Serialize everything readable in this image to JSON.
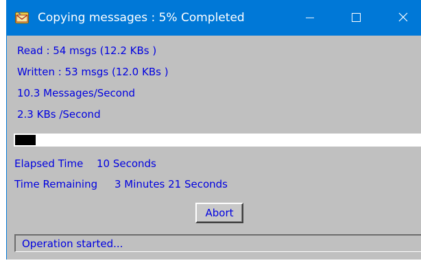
{
  "window": {
    "title": "Copying messages : 5% Completed",
    "controls": {
      "minimize_icon": "minimize-icon",
      "maximize_icon": "maximize-icon",
      "close_icon": "close-icon"
    },
    "app_icon": "mail-envelope-icon"
  },
  "stats": {
    "read": "Read : 54 msgs (12.2 KBs )",
    "written": "Written : 53 msgs (12.0 KBs )",
    "messages_rate": "10.3 Messages/Second",
    "kb_rate": "2.3 KBs /Second"
  },
  "progress": {
    "percent": 5
  },
  "timing": {
    "elapsed_label": "Elapsed Time",
    "elapsed_value": "10 Seconds",
    "remaining_label": "Time Remaining",
    "remaining_value": "3 Minutes 21 Seconds"
  },
  "actions": {
    "abort_label": "Abort"
  },
  "status": {
    "text": "Operation started..."
  },
  "colors": {
    "titlebar": "#0078d7",
    "dialog_bg": "#c0c0c0",
    "text": "#0000e0",
    "progress_fill": "#000000",
    "progress_track": "#ffffff"
  }
}
